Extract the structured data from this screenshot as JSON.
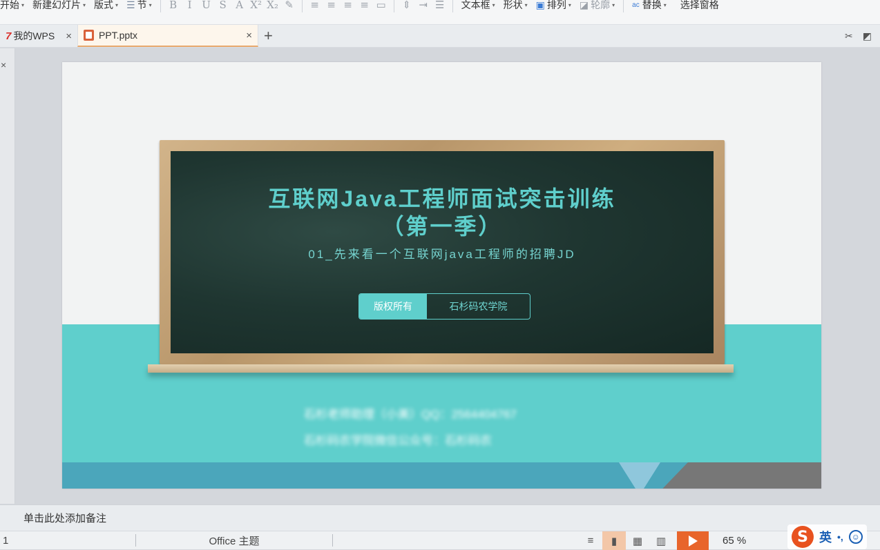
{
  "ribbon": {
    "items": [
      {
        "label": "开始",
        "caret": "▾"
      },
      {
        "label": "新建幻灯片",
        "caret": "▾"
      },
      {
        "label": "版式",
        "caret": "▾"
      },
      {
        "label": "节",
        "caret": "▾"
      }
    ],
    "format_icons": [
      "B",
      "I",
      "U",
      "S",
      "A",
      "X²",
      "X₂"
    ],
    "right_items": [
      {
        "label": "文本框",
        "caret": "▾"
      },
      {
        "label": "形状",
        "caret": "▾"
      },
      {
        "label": "排列",
        "caret": "▾"
      },
      {
        "label": "轮廓",
        "caret": "▾"
      },
      {
        "label": "替换",
        "caret": "▾"
      },
      {
        "label": "选择窗格"
      }
    ]
  },
  "tabs": {
    "home_label": "我的WPS",
    "doc_label": "PPT.pptx",
    "close_glyph": "×",
    "new_glyph": "+"
  },
  "slide": {
    "title_line1": "互联网Java工程师面试突击训练",
    "title_line2": "（第一季）",
    "subtitle": "01_先来看一个互联网java工程师的招聘JD",
    "pill_left": "版权所有",
    "pill_right": "石杉码农学院",
    "blurred_line1": "石杉老师助理（小美）QQ：2564404767",
    "blurred_line2": "石杉码农学院微信公众号：石杉码农"
  },
  "notes": {
    "placeholder": "单击此处添加备注"
  },
  "status": {
    "slide_number": "1",
    "theme": "Office 主题",
    "zoom": "65 %"
  },
  "ime": {
    "logo": "S",
    "lang": "英",
    "punct": "•,"
  },
  "colors": {
    "teal": "#5fcfcc",
    "board": "#1f3631",
    "play": "#e8652b"
  }
}
